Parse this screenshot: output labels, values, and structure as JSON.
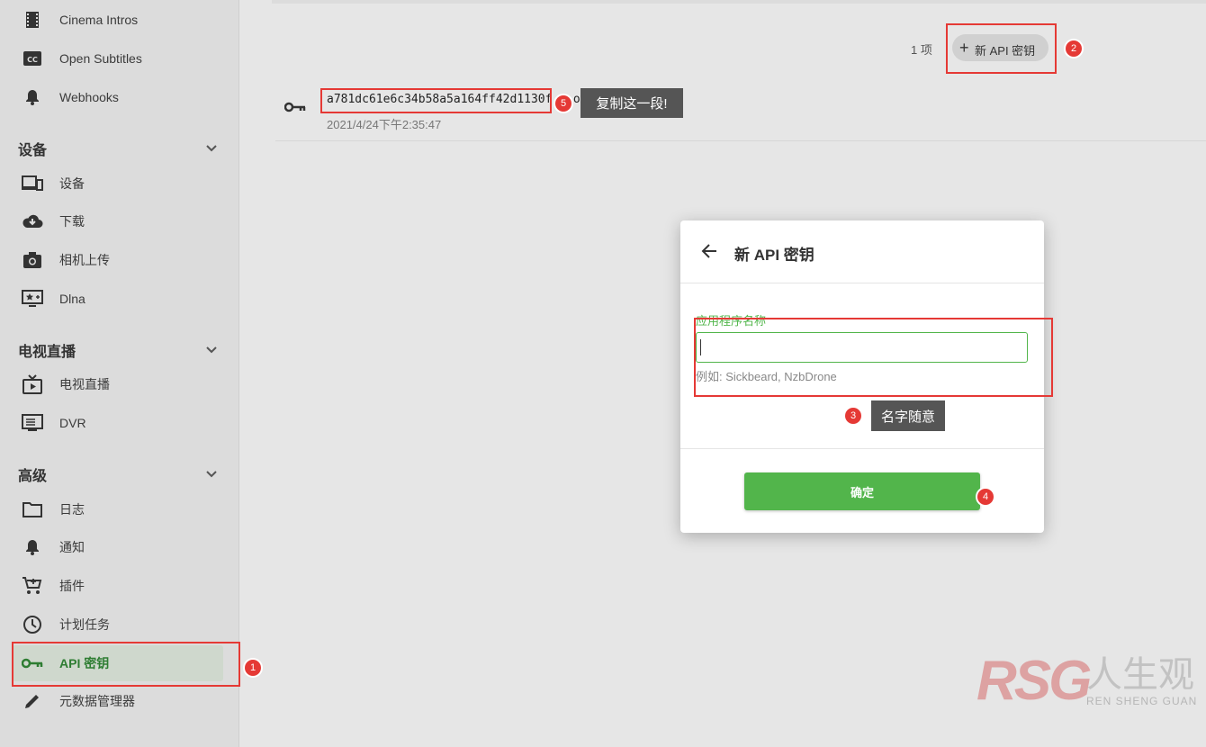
{
  "sidebar": {
    "items_top": [
      {
        "label": "Cinema Intros",
        "icon": "film-icon"
      },
      {
        "label": "Open Subtitles",
        "icon": "closed-caption-icon"
      },
      {
        "label": "Webhooks",
        "icon": "bell-icon"
      }
    ],
    "sections": [
      {
        "title": "设备",
        "items": [
          {
            "label": "设备",
            "icon": "devices-icon"
          },
          {
            "label": "下载",
            "icon": "cloud-download-icon"
          },
          {
            "label": "相机上传",
            "icon": "camera-icon"
          },
          {
            "label": "Dlna",
            "icon": "dlna-icon"
          }
        ]
      },
      {
        "title": "电视直播",
        "items": [
          {
            "label": "电视直播",
            "icon": "live-tv-icon"
          },
          {
            "label": "DVR",
            "icon": "dvr-icon"
          }
        ]
      },
      {
        "title": "高级",
        "items": [
          {
            "label": "日志",
            "icon": "folder-icon"
          },
          {
            "label": "通知",
            "icon": "bell-icon"
          },
          {
            "label": "插件",
            "icon": "cart-icon"
          },
          {
            "label": "计划任务",
            "icon": "clock-icon"
          },
          {
            "label": "API 密钥",
            "icon": "key-icon",
            "active": true
          },
          {
            "label": "元数据管理器",
            "icon": "pencil-icon"
          }
        ]
      }
    ]
  },
  "toolbar": {
    "count": "1 项",
    "new_button_label": "新 API 密钥"
  },
  "key_row": {
    "token": "a781dc61e6c34b58a5a164ff42d1130f",
    "suffix": " - om",
    "date": "2021/4/24下午2:35:47"
  },
  "dialog": {
    "title": "新 API 密钥",
    "field_label": "应用程序名称",
    "input_value": "",
    "hint": "例如: Sickbeard, NzbDrone",
    "ok_label": "确定"
  },
  "annotations": {
    "badges": [
      "1",
      "2",
      "3",
      "4",
      "5"
    ],
    "tip_copy": "复制这一段!",
    "tip_name": "名字随意"
  },
  "watermark": {
    "logo": "RSG",
    "cn": "人生观",
    "pinyin": "REN SHENG GUAN"
  },
  "colors": {
    "accent": "#52b54b",
    "annotation_red": "#e53935"
  }
}
